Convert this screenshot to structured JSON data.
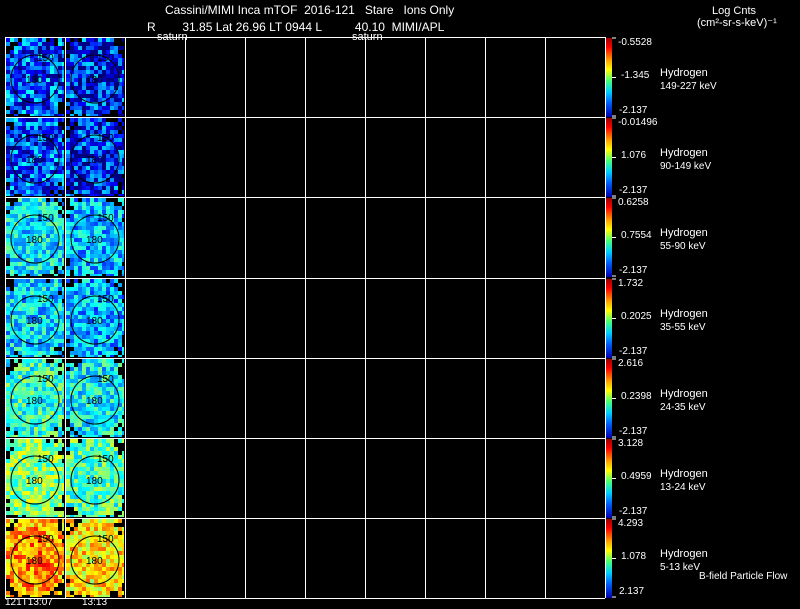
{
  "header": {
    "title": "Cassini/MIMI Inca mTOF  2016-121   Stare   Ions Only",
    "info": "R        31.85 Lat 26.96 LT 0944 L          40.10  MIMI/APL",
    "saturn_labels": [
      "saturn",
      "saturn"
    ],
    "units_title": "Log Cnts",
    "units": "(cm²-sr-s-keV)⁻¹"
  },
  "panels": [
    {
      "species": "Hydrogen",
      "energy": "149-227 keV",
      "cbar": {
        "max": "-0.5528",
        "mid": "-1.345",
        "min": "-2.137"
      }
    },
    {
      "species": "Hydrogen",
      "energy": "90-149 keV",
      "cbar": {
        "max": "-0.01496",
        "mid": "1.076",
        "min": "-2.137"
      }
    },
    {
      "species": "Hydrogen",
      "energy": "55-90 keV",
      "cbar": {
        "max": "0.6258",
        "mid": "0.7554",
        "min": "-2.137"
      }
    },
    {
      "species": "Hydrogen",
      "energy": "35-55 keV",
      "cbar": {
        "max": "1.732",
        "mid": "0.2025",
        "min": "-2.137"
      }
    },
    {
      "species": "Hydrogen",
      "energy": "24-35 keV",
      "cbar": {
        "max": "2.616",
        "mid": "0.2398",
        "min": "-2.137"
      }
    },
    {
      "species": "Hydrogen",
      "energy": "13-24 keV",
      "cbar": {
        "max": "3.128",
        "mid": "0.4959",
        "min": "-2.137"
      }
    },
    {
      "species": "Hydrogen",
      "energy": "5-13 keV",
      "cbar": {
        "max": "4.293",
        "mid": "1.078",
        "min": "2.137"
      }
    }
  ],
  "image_labels": {
    "angle_inner": "180",
    "angle_outer": "150"
  },
  "footer": {
    "time_labels": [
      "121T13:07",
      "13:13"
    ],
    "legend": "B-field Particle Flow"
  },
  "colors": {
    "background": "#000000",
    "grid": "#ffffff",
    "colorbar": [
      "#800000",
      "#ff0000",
      "#ffa500",
      "#ffff00",
      "#00ff80",
      "#00c8ff",
      "#0050ff",
      "#0000a0"
    ]
  }
}
